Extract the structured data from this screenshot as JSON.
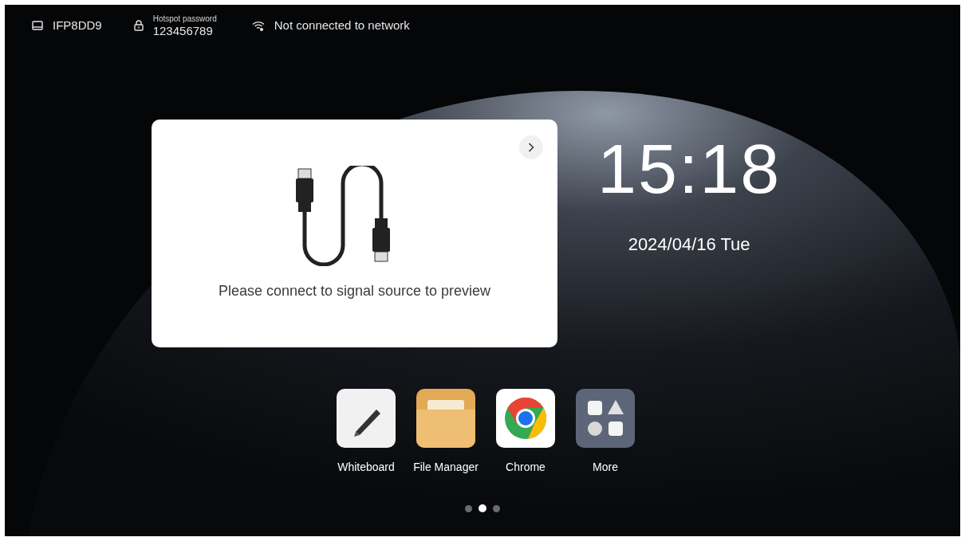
{
  "status_bar": {
    "device_name": "IFP8DD9",
    "hotspot_label": "Hotspot password",
    "hotspot_password": "123456789",
    "network": "Not connected to network"
  },
  "preview_card": {
    "message": "Please connect to signal source to preview"
  },
  "clock": {
    "time": "15:18",
    "date": "2024/04/16 Tue"
  },
  "apps": [
    {
      "kind": "whiteboard",
      "label": "Whiteboard"
    },
    {
      "kind": "folder",
      "label": "File Manager"
    },
    {
      "kind": "browser",
      "label": "Chrome"
    },
    {
      "kind": "more",
      "label": "More"
    }
  ],
  "page_dots": [
    {
      "selected": false
    },
    {
      "selected": true
    },
    {
      "selected": false
    }
  ]
}
